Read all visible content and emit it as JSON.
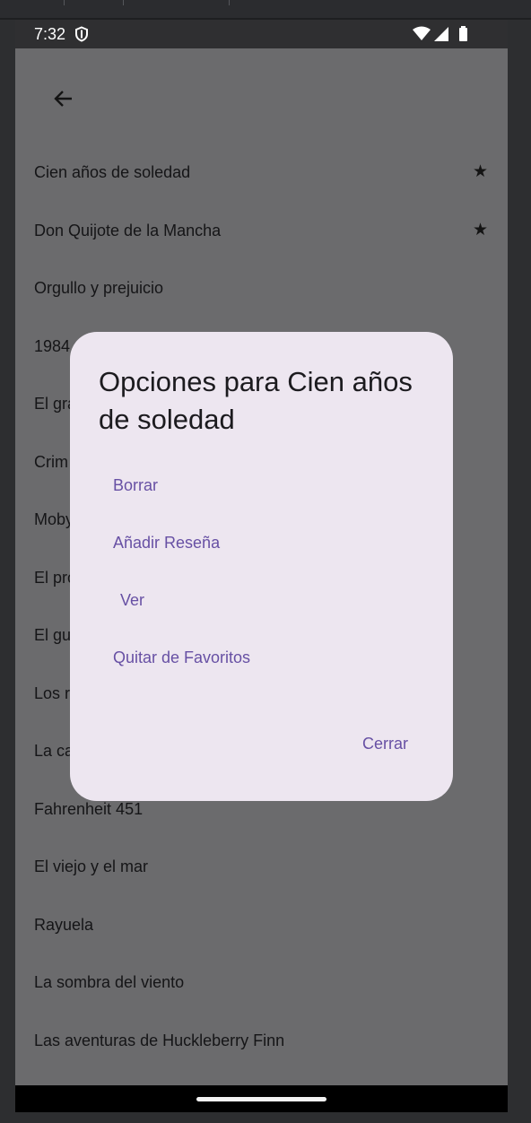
{
  "status_bar": {
    "time": "7:32"
  },
  "icons": {
    "shield": "shield-icon",
    "wifi": "wifi-icon",
    "signal": "signal-icon",
    "battery": "battery-icon",
    "back": "arrow-back-icon",
    "star": "star-icon"
  },
  "books": [
    {
      "title": "Cien años de soledad",
      "favorite": true
    },
    {
      "title": "Don Quijote de la Mancha",
      "favorite": true
    },
    {
      "title": "Orgullo y prejuicio",
      "favorite": false
    },
    {
      "title": "1984",
      "favorite": false
    },
    {
      "title": "El gra",
      "favorite": false
    },
    {
      "title": "Crim",
      "favorite": false
    },
    {
      "title": "Moby",
      "favorite": false
    },
    {
      "title": "El pro",
      "favorite": false
    },
    {
      "title": "El gu",
      "favorite": false
    },
    {
      "title": "Los r",
      "favorite": false
    },
    {
      "title": "La ca",
      "favorite": false
    },
    {
      "title": "Fahrenheit 451",
      "favorite": false
    },
    {
      "title": "El viejo y el mar",
      "favorite": false
    },
    {
      "title": "Rayuela",
      "favorite": false
    },
    {
      "title": "La sombra del viento",
      "favorite": false
    },
    {
      "title": "Las aventuras de Huckleberry Finn",
      "favorite": false
    }
  ],
  "star_glyph": "★",
  "dialog": {
    "title": "Opciones para Cien años de soledad",
    "options": [
      "Borrar",
      "Añadir Reseña",
      "Ver",
      "Quitar de Favoritos"
    ],
    "close": "Cerrar"
  },
  "colors": {
    "scrim": "#6b6b6d",
    "dialog_bg": "#ede6f0",
    "accent": "#6750a4",
    "status_bar": "#2f2f31"
  }
}
